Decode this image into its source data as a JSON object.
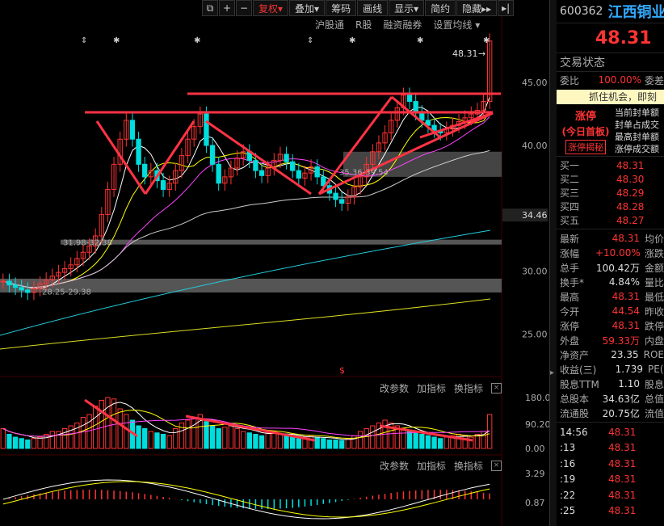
{
  "toolbar": {
    "items": [
      {
        "name": "window-icon",
        "label": "⧉",
        "icon": true
      },
      {
        "name": "zoom-in-button",
        "label": "+",
        "icon": true
      },
      {
        "name": "zoom-out-button",
        "label": "−",
        "icon": true
      },
      {
        "name": "adjust-rights-button",
        "label": "复权▾",
        "active": true
      },
      {
        "name": "overlay-button",
        "label": "叠加▾"
      },
      {
        "name": "chips-button",
        "label": "筹码"
      },
      {
        "name": "draw-line-button",
        "label": "画线"
      },
      {
        "name": "display-button",
        "label": "显示▾"
      },
      {
        "name": "simple-button",
        "label": "简约"
      },
      {
        "name": "hide-button",
        "label": "隐藏▸▸"
      },
      {
        "name": "next-button",
        "label": "▸|",
        "icon": true
      }
    ]
  },
  "subbar": {
    "hgt": "沪股通",
    "r": "R股",
    "margin": "融资融券",
    "settings": "设置均线 ▾"
  },
  "price_axis": {
    "ticks": [
      {
        "v": 45,
        "label": "45.00"
      },
      {
        "v": 40,
        "label": "40.00"
      },
      {
        "v": 30,
        "label": "30.00"
      },
      {
        "v": 25,
        "label": "25.00"
      }
    ],
    "current_marker": "34.46",
    "last_label": "48.31"
  },
  "annotations": {
    "r1": "31.98-32.38",
    "r2": "28.25-29.38",
    "r3": "35.36-39.54"
  },
  "volume_axis": [
    "180.00",
    "90.20",
    "0.00"
  ],
  "macd_axis": [
    "3.29",
    "0.87"
  ],
  "panel": {
    "params": "改参数",
    "add": "加指标",
    "change": "换指标",
    "close": "×"
  },
  "chart_data": {
    "type": "candlestick",
    "price_range": [
      22,
      49
    ],
    "close": [
      29.2,
      28.9,
      28.7,
      28.5,
      28.3,
      28.6,
      29.0,
      29.3,
      29.6,
      29.9,
      30.2,
      30.5,
      31.0,
      31.5,
      32.0,
      32.8,
      34.5,
      36.5,
      38.5,
      40.5,
      42.0,
      40.5,
      38.5,
      37.5,
      38.0,
      37.2,
      36.5,
      37.0,
      38.0,
      39.2,
      40.5,
      41.5,
      42.5,
      40.0,
      38.5,
      37.0,
      37.5,
      38.2,
      39.0,
      39.5,
      38.8,
      38.0,
      37.6,
      38.2,
      38.8,
      39.3,
      38.7,
      38.0,
      37.4,
      37.8,
      38.3,
      37.5,
      36.8,
      36.2,
      35.7,
      35.4,
      35.9,
      36.7,
      37.5,
      38.5,
      39.5,
      40.2,
      41.0,
      42.0,
      43.0,
      44.0,
      43.5,
      42.6,
      42.0,
      41.6,
      41.2,
      41.0,
      41.3,
      41.6,
      41.9,
      42.2,
      42.5,
      42.8,
      43.5,
      48.31
    ],
    "volume": [
      70,
      50,
      40,
      35,
      30,
      35,
      40,
      50,
      60,
      60,
      70,
      80,
      90,
      110,
      120,
      150,
      170,
      180,
      175,
      140,
      120,
      100,
      80,
      70,
      60,
      55,
      50,
      45,
      70,
      90,
      100,
      110,
      120,
      95,
      80,
      70,
      75,
      80,
      70,
      60,
      55,
      50,
      45,
      55,
      60,
      50,
      45,
      40,
      35,
      40,
      45,
      40,
      35,
      30,
      30,
      28,
      35,
      45,
      60,
      70,
      80,
      90,
      100,
      90,
      80,
      70,
      60,
      55,
      50,
      45,
      40,
      35,
      40,
      45,
      50,
      45,
      40,
      50,
      60,
      120
    ],
    "volume_range": [
      0,
      180
    ]
  },
  "quote": {
    "code": "600362",
    "name": "江西铜业",
    "price": "48.31",
    "limit": "涨停",
    "status_label": "交易状态",
    "ratio_label": "委比",
    "ratio_value": "100.00%",
    "ratio_right": "委差",
    "opportunity": "抓住机会，即刻",
    "lim": {
      "t1": "涨停",
      "t2": "(今日首板)",
      "t3": "涨停揭秘",
      "lines": [
        "当前封单额",
        "封单占成交",
        "最高封单额",
        "涨停成交额"
      ]
    },
    "book": [
      {
        "l": "买一",
        "v": "48.31"
      },
      {
        "l": "买二",
        "v": "48.30"
      },
      {
        "l": "买三",
        "v": "48.29"
      },
      {
        "l": "买四",
        "v": "48.28"
      },
      {
        "l": "买五",
        "v": "48.27"
      }
    ],
    "stats": [
      {
        "l": "最新",
        "v": "48.31",
        "r": "均价"
      },
      {
        "l": "涨幅",
        "v": "+10.00%",
        "r": "涨跌"
      },
      {
        "l": "总手",
        "v": "100.42万",
        "r": "金额",
        "white": true
      },
      {
        "l": "换手*",
        "v": "4.84%",
        "r": "量比",
        "white": true
      },
      {
        "l": "最高",
        "v": "48.31",
        "r": "最低"
      },
      {
        "l": "今开",
        "v": "44.54",
        "r": "昨收"
      },
      {
        "l": "涨停",
        "v": "48.31",
        "r": "跌停"
      },
      {
        "l": "外盘",
        "v": "59.33万",
        "r": "内盘"
      },
      {
        "l": "净资产",
        "v": "23.35",
        "r": "ROE",
        "white": true
      },
      {
        "l": "收益(三)",
        "v": "1.739",
        "r": "PE(",
        "white": true
      },
      {
        "l": "股息TTM",
        "v": "1.10",
        "r": "股息",
        "white": true
      },
      {
        "l": "总股本",
        "v": "34.63亿",
        "r": "总值",
        "white": true
      },
      {
        "l": "流通股",
        "v": "20.75亿",
        "r": "流值",
        "white": true
      }
    ],
    "ticks": [
      {
        "t": "14:56",
        "p": "48.31"
      },
      {
        "t": ":13",
        "p": "48.31"
      },
      {
        "t": ":16",
        "p": "48.31"
      },
      {
        "t": ":19",
        "p": "48.31"
      },
      {
        "t": ":22",
        "p": "48.31"
      },
      {
        "t": ":25",
        "p": "48.31"
      }
    ]
  }
}
